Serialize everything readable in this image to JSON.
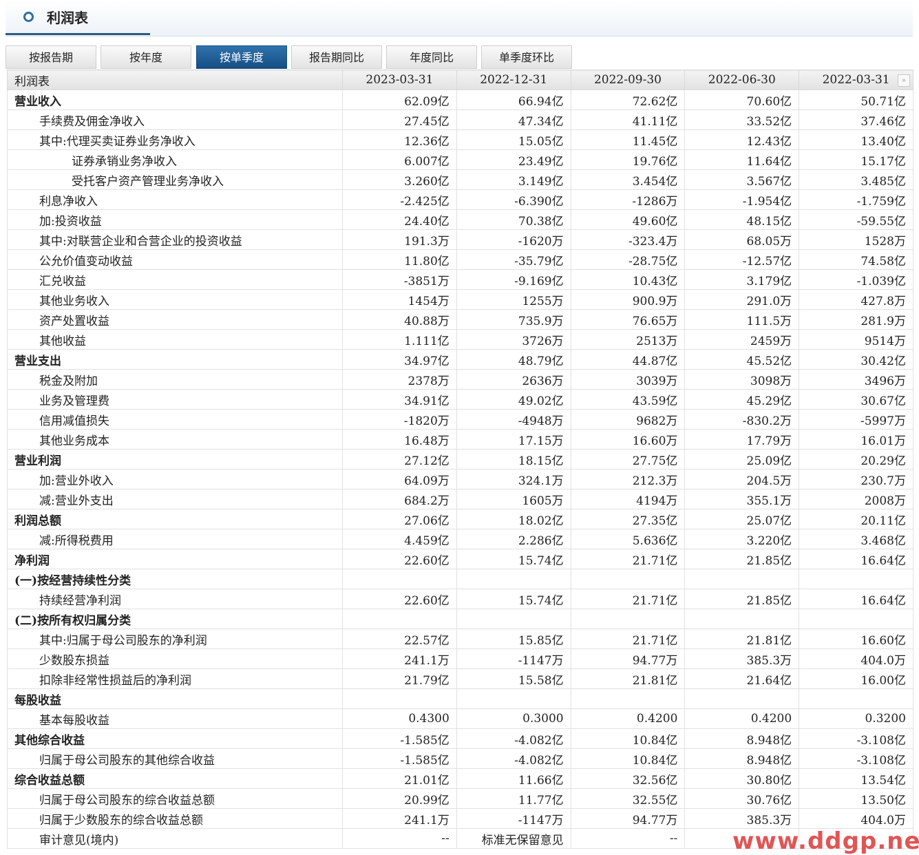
{
  "header": {
    "title": "利润表"
  },
  "tabs": [
    {
      "label": "按报告期"
    },
    {
      "label": "按年度"
    },
    {
      "label": "按单季度",
      "active": true
    },
    {
      "label": "报告期同比"
    },
    {
      "label": "年度同比"
    },
    {
      "label": "单季度环比"
    }
  ],
  "table": {
    "corner": "利润表",
    "columns": [
      "2023-03-31",
      "2022-12-31",
      "2022-09-30",
      "2022-06-30",
      "2022-03-31"
    ],
    "rows": [
      {
        "label": "营业收入",
        "style": "bold",
        "values": [
          "62.09亿",
          "66.94亿",
          "72.62亿",
          "70.60亿",
          "50.71亿"
        ]
      },
      {
        "label": "手续费及佣金净收入",
        "style": "i1",
        "values": [
          "27.45亿",
          "47.34亿",
          "41.11亿",
          "33.52亿",
          "37.46亿"
        ]
      },
      {
        "label": "其中:代理买卖证券业务净收入",
        "style": "i1",
        "values": [
          "12.36亿",
          "15.05亿",
          "11.45亿",
          "12.43亿",
          "13.40亿"
        ]
      },
      {
        "label": "证券承销业务净收入",
        "style": "i2",
        "values": [
          "6.007亿",
          "23.49亿",
          "19.76亿",
          "11.64亿",
          "15.17亿"
        ]
      },
      {
        "label": "受托客户资产管理业务净收入",
        "style": "i2",
        "values": [
          "3.260亿",
          "3.149亿",
          "3.454亿",
          "3.567亿",
          "3.485亿"
        ]
      },
      {
        "label": "利息净收入",
        "style": "i1",
        "values": [
          "-2.425亿",
          "-6.390亿",
          "-1286万",
          "-1.954亿",
          "-1.759亿"
        ]
      },
      {
        "label": "加:投资收益",
        "style": "i1",
        "values": [
          "24.40亿",
          "70.38亿",
          "49.60亿",
          "48.15亿",
          "-59.55亿"
        ]
      },
      {
        "label": "其中:对联营企业和合营企业的投资收益",
        "style": "i1",
        "values": [
          "191.3万",
          "-1620万",
          "-323.4万",
          "68.05万",
          "1528万"
        ]
      },
      {
        "label": "公允价值变动收益",
        "style": "i1",
        "values": [
          "11.80亿",
          "-35.79亿",
          "-28.75亿",
          "-12.57亿",
          "74.58亿"
        ]
      },
      {
        "label": "汇兑收益",
        "style": "i1",
        "values": [
          "-3851万",
          "-9.169亿",
          "10.43亿",
          "3.179亿",
          "-1.039亿"
        ]
      },
      {
        "label": "其他业务收入",
        "style": "i1",
        "values": [
          "1454万",
          "1255万",
          "900.9万",
          "291.0万",
          "427.8万"
        ]
      },
      {
        "label": "资产处置收益",
        "style": "i1",
        "values": [
          "40.88万",
          "735.9万",
          "76.65万",
          "111.5万",
          "281.9万"
        ]
      },
      {
        "label": "其他收益",
        "style": "i1",
        "values": [
          "1.111亿",
          "3726万",
          "2513万",
          "2459万",
          "9514万"
        ]
      },
      {
        "label": "营业支出",
        "style": "bold",
        "values": [
          "34.97亿",
          "48.79亿",
          "44.87亿",
          "45.52亿",
          "30.42亿"
        ]
      },
      {
        "label": "税金及附加",
        "style": "i1",
        "values": [
          "2378万",
          "2636万",
          "3039万",
          "3098万",
          "3496万"
        ]
      },
      {
        "label": "业务及管理费",
        "style": "i1",
        "values": [
          "34.91亿",
          "49.02亿",
          "43.59亿",
          "45.29亿",
          "30.67亿"
        ]
      },
      {
        "label": "信用减值损失",
        "style": "i1",
        "values": [
          "-1820万",
          "-4948万",
          "9682万",
          "-830.2万",
          "-5997万"
        ]
      },
      {
        "label": "其他业务成本",
        "style": "i1",
        "values": [
          "16.48万",
          "17.15万",
          "16.60万",
          "17.79万",
          "16.01万"
        ]
      },
      {
        "label": "营业利润",
        "style": "bold",
        "values": [
          "27.12亿",
          "18.15亿",
          "27.75亿",
          "25.09亿",
          "20.29亿"
        ]
      },
      {
        "label": "加:营业外收入",
        "style": "i1",
        "values": [
          "64.09万",
          "324.1万",
          "212.3万",
          "204.5万",
          "230.7万"
        ]
      },
      {
        "label": "减:营业外支出",
        "style": "i1",
        "values": [
          "684.2万",
          "1605万",
          "4194万",
          "355.1万",
          "2008万"
        ]
      },
      {
        "label": "利润总额",
        "style": "bold",
        "values": [
          "27.06亿",
          "18.02亿",
          "27.35亿",
          "25.07亿",
          "20.11亿"
        ]
      },
      {
        "label": "减:所得税费用",
        "style": "i1",
        "values": [
          "4.459亿",
          "2.286亿",
          "5.636亿",
          "3.220亿",
          "3.468亿"
        ]
      },
      {
        "label": "净利润",
        "style": "bold",
        "values": [
          "22.60亿",
          "15.74亿",
          "21.71亿",
          "21.85亿",
          "16.64亿"
        ]
      },
      {
        "label": "(一)按经营持续性分类",
        "style": "bold",
        "values": [
          "",
          "",
          "",
          "",
          ""
        ]
      },
      {
        "label": "持续经营净利润",
        "style": "i1",
        "values": [
          "22.60亿",
          "15.74亿",
          "21.71亿",
          "21.85亿",
          "16.64亿"
        ]
      },
      {
        "label": "(二)按所有权归属分类",
        "style": "bold",
        "values": [
          "",
          "",
          "",
          "",
          ""
        ]
      },
      {
        "label": "其中:归属于母公司股东的净利润",
        "style": "i1",
        "values": [
          "22.57亿",
          "15.85亿",
          "21.71亿",
          "21.81亿",
          "16.60亿"
        ]
      },
      {
        "label": "少数股东损益",
        "style": "i1",
        "values": [
          "241.1万",
          "-1147万",
          "94.77万",
          "385.3万",
          "404.0万"
        ]
      },
      {
        "label": "扣除非经常性损益后的净利润",
        "style": "i1",
        "values": [
          "21.79亿",
          "15.58亿",
          "21.81亿",
          "21.64亿",
          "16.00亿"
        ]
      },
      {
        "label": "每股收益",
        "style": "bold",
        "values": [
          "",
          "",
          "",
          "",
          ""
        ]
      },
      {
        "label": "基本每股收益",
        "style": "i1",
        "values": [
          "0.4300",
          "0.3000",
          "0.4200",
          "0.4200",
          "0.3200"
        ]
      },
      {
        "label": "其他综合收益",
        "style": "bold",
        "values": [
          "-1.585亿",
          "-4.082亿",
          "10.84亿",
          "8.948亿",
          "-3.108亿"
        ]
      },
      {
        "label": "归属于母公司股东的其他综合收益",
        "style": "i1",
        "values": [
          "-1.585亿",
          "-4.082亿",
          "10.84亿",
          "8.948亿",
          "-3.108亿"
        ]
      },
      {
        "label": "综合收益总额",
        "style": "bold",
        "values": [
          "21.01亿",
          "11.66亿",
          "32.56亿",
          "30.80亿",
          "13.54亿"
        ]
      },
      {
        "label": "归属于母公司股东的综合收益总额",
        "style": "i1",
        "values": [
          "20.99亿",
          "11.77亿",
          "32.55亿",
          "30.76亿",
          "13.50亿"
        ]
      },
      {
        "label": "归属于少数股东的综合收益总额",
        "style": "i1",
        "values": [
          "241.1万",
          "-1147万",
          "94.77万",
          "385.3万",
          "404.0万"
        ]
      },
      {
        "label": "审计意见(境内)",
        "style": "i1",
        "values": [
          "--",
          "标准无保留意见",
          "--",
          "",
          ""
        ]
      }
    ]
  },
  "icons": {
    "more": "double-chevron-right-icon",
    "header": "circle-icon"
  },
  "watermark": "www.ddgp.net"
}
